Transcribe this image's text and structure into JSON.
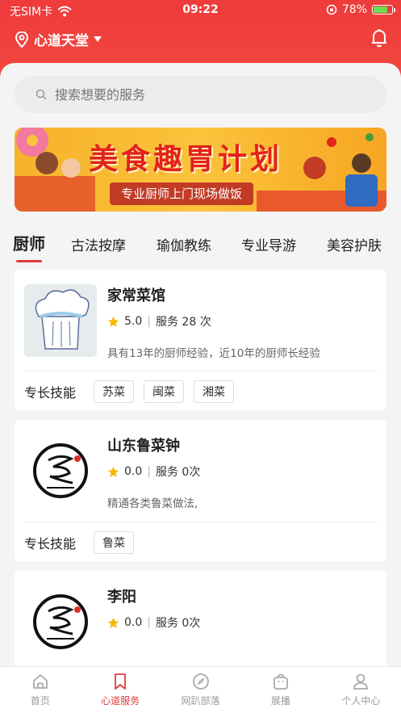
{
  "status_bar": {
    "carrier": "无SIM卡",
    "time": "09:22",
    "battery": "78%",
    "battery_level": 0.78
  },
  "header": {
    "location": "心道天堂"
  },
  "search": {
    "placeholder": "搜索想要的服务"
  },
  "banner": {
    "title": "美食趣胃计划",
    "subtitle": "专业厨师上门现场做饭"
  },
  "tabs": [
    {
      "label": "厨师",
      "active": true
    },
    {
      "label": "古法按摩"
    },
    {
      "label": "瑜伽教练"
    },
    {
      "label": "专业导游"
    },
    {
      "label": "美容护肤"
    }
  ],
  "cards": [
    {
      "name": "家常菜馆",
      "rating": "5.0",
      "services": "服务 28 次",
      "desc": "具有13年的厨师经验，近10年的厨师长经验",
      "skills_label": "专长技能",
      "skills": [
        "苏菜",
        "闽菜",
        "湘菜"
      ]
    },
    {
      "name": "山东鲁菜钟",
      "rating": "0.0",
      "services": "服务 0次",
      "desc": "精通各类鲁菜做法,",
      "skills_label": "专长技能",
      "skills": [
        "鲁菜"
      ]
    },
    {
      "name": "李阳",
      "rating": "0.0",
      "services": "服务 0次"
    }
  ],
  "tabbar": [
    {
      "label": "首页",
      "icon": "home-icon"
    },
    {
      "label": "心道服务",
      "icon": "bookmark-icon",
      "active": true
    },
    {
      "label": "网趴部落",
      "icon": "compass-icon"
    },
    {
      "label": "展播",
      "icon": "bag-icon"
    },
    {
      "label": "个人中心",
      "icon": "user-icon"
    }
  ],
  "colors": {
    "brand": "#e23b3b",
    "banner": "#fbc33c",
    "star": "#f5b800"
  }
}
